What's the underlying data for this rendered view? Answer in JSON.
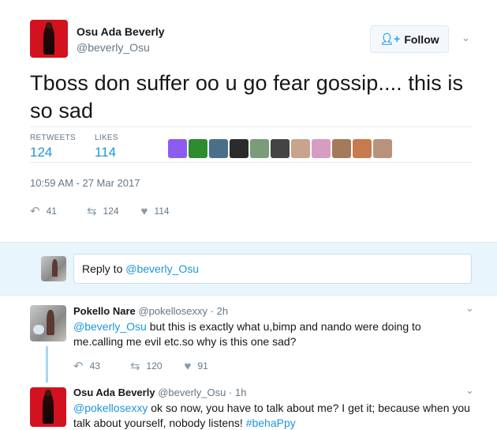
{
  "author": {
    "name": "Osu Ada Beverly",
    "handle": "@beverly_Osu"
  },
  "follow_button": {
    "icon": "add-user-icon",
    "label": "Follow"
  },
  "tweet": {
    "text": "Tboss don suffer oo u go fear gossip.... this is so sad",
    "retweets_label": "RETWEETS",
    "retweets": "124",
    "likes_label": "LIKES",
    "likes": "114",
    "timestamp": "10:59 AM - 27 Mar 2017",
    "actions": {
      "replies": "41",
      "retweets": "124",
      "likes": "114"
    },
    "likers": [
      {
        "icon": "egg-avatar",
        "color": "#8c5cf0"
      },
      {
        "icon": "leaf-avatar",
        "color": "#2e8b2e"
      },
      {
        "icon": "person-avatar",
        "color": "#4a6f8a"
      },
      {
        "icon": "person-avatar",
        "color": "#2b2b2b"
      },
      {
        "icon": "person-avatar",
        "color": "#7a9c78"
      },
      {
        "icon": "silhouette-avatar",
        "color": "#444444"
      },
      {
        "icon": "person-avatar",
        "color": "#c9a38d"
      },
      {
        "icon": "person-avatar",
        "color": "#d89cc3"
      },
      {
        "icon": "person-avatar",
        "color": "#a37b5a"
      },
      {
        "icon": "person-avatar",
        "color": "#c77a4e"
      },
      {
        "icon": "person-avatar",
        "color": "#b8927b"
      }
    ]
  },
  "reply_box": {
    "prefix": "Reply to ",
    "handle": "@beverly_Osu"
  },
  "replies": [
    {
      "name": "Pokello Nare",
      "handle": "@pokellosexxy",
      "time": "2h",
      "mention": "@beverly_Osu",
      "text": " but this is exactly what u,bimp and nando were doing to me.calling me evil etc.so why is this one sad?",
      "actions": {
        "replies": "43",
        "retweets": "120",
        "likes": "91"
      }
    },
    {
      "name": "Osu Ada Beverly",
      "handle": "@beverly_Osu",
      "time": "1h",
      "mention": "@pokellosexxy",
      "text": " ok so now, you have to talk about me? I get it; because when you talk about yourself, nobody listens! ",
      "hashtag": "#behaPpy"
    }
  ],
  "colors": {
    "accent": "#1b95e0",
    "muted": "#657786",
    "reply_bar": "#e8f5fd",
    "avatar_red": "#d3121f"
  }
}
